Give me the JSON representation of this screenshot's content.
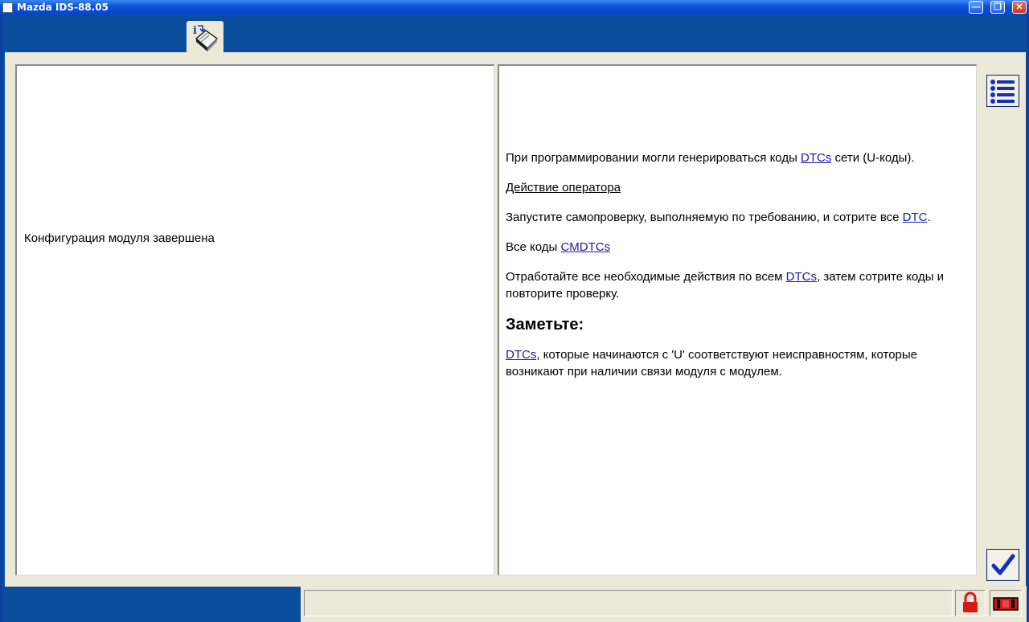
{
  "window": {
    "title": "Mazda IDS-88.05",
    "controls": {
      "minimize": "minimize",
      "maximize": "maximize",
      "close": "close"
    }
  },
  "tabs": [
    {
      "icon": "info-book-icon",
      "active": true
    }
  ],
  "left_panel": {
    "message": "Конфигурация модуля завершена"
  },
  "right_panel": {
    "p1_before": "При программировании могли генерироваться коды ",
    "p1_link": "DTCs",
    "p1_after": " сети (U-коды).",
    "operator_action": "Действие оператора",
    "p3_before": "Запустите самопроверку, выполняемую по требованию, и сотрите все ",
    "p3_link": "DTC",
    "p3_after": ".",
    "p4_before": "Все коды ",
    "p4_link": "CMDTCs",
    "p5_before": "Отработайте все необходимые действия по всем ",
    "p5_link": "DTCs",
    "p5_after": ", затем сотрите коды и повторите проверку.",
    "note_heading": "Заметьте:",
    "p6_link": "DTCs",
    "p6_after": ", которые начинаются с 'U' соответствуют неисправностям, которые возникают при наличии связи модуля с модулем."
  },
  "side_buttons": {
    "list": "list-icon",
    "ok": "checkmark-icon"
  },
  "status_bar": {
    "text": "",
    "lock": "lock-icon",
    "vci": "vci-icon"
  },
  "colors": {
    "frame_blue": "#0a4d9c",
    "panel_bg": "#ece9d8",
    "link": "#1a1aa6"
  }
}
